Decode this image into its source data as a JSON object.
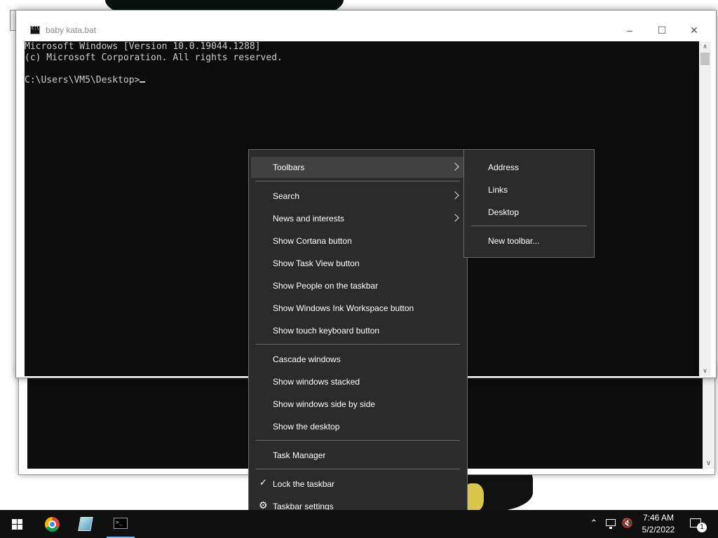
{
  "window": {
    "title": "baby kata.bat",
    "console_lines": [
      "Microsoft Windows [Version 10.0.19044.1288]",
      "(c) Microsoft Corporation. All rights reserved.",
      "",
      "C:\\Users\\VM5\\Desktop>"
    ]
  },
  "context_menu": {
    "items": [
      {
        "label": "Toolbars",
        "submenu": true,
        "highlighted": true
      },
      {
        "label": "Search",
        "submenu": true
      },
      {
        "label": "News and interests",
        "submenu": true
      },
      {
        "label": "Show Cortana button"
      },
      {
        "label": "Show Task View button"
      },
      {
        "label": "Show People on the taskbar"
      },
      {
        "label": "Show Windows Ink Workspace button"
      },
      {
        "label": "Show touch keyboard button"
      },
      {
        "label": "Cascade windows"
      },
      {
        "label": "Show windows stacked"
      },
      {
        "label": "Show windows side by side"
      },
      {
        "label": "Show the desktop"
      },
      {
        "label": "Task Manager"
      },
      {
        "label": "Lock the taskbar",
        "checked": true
      },
      {
        "label": "Taskbar settings",
        "icon": "gear-icon"
      }
    ]
  },
  "toolbars_submenu": {
    "items": [
      "Address",
      "Links",
      "Desktop",
      "New toolbar..."
    ]
  },
  "taskbar": {
    "pinned": [
      "windows-start-icon",
      "chrome-icon",
      "notepad-icon",
      "command-prompt-icon"
    ],
    "clock_time": "7:46 AM",
    "clock_date": "5/2/2022",
    "notification_count": "1"
  },
  "colors": {
    "menu_bg": "#2b2b2b",
    "menu_highlight": "#414141",
    "console_bg": "#0c0c0c",
    "taskbar_bg": "#101010"
  }
}
